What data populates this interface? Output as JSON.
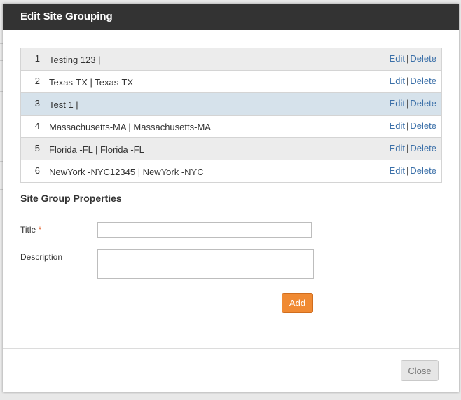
{
  "modal": {
    "title": "Edit Site Grouping"
  },
  "site_groups": [
    {
      "index": "1",
      "name": "Testing 123 |"
    },
    {
      "index": "2",
      "name": "Texas-TX | Texas-TX"
    },
    {
      "index": "3",
      "name": "Test 1 |"
    },
    {
      "index": "4",
      "name": "Massachusetts-MA | Massachusetts-MA"
    },
    {
      "index": "5",
      "name": "Florida -FL | Florida -FL"
    },
    {
      "index": "6",
      "name": "NewYork -NYC12345 | NewYork -NYC"
    }
  ],
  "row_actions": {
    "edit_label": "Edit",
    "separator": "|",
    "delete_label": "Delete"
  },
  "properties": {
    "section_title": "Site Group Properties",
    "title_label": "Title",
    "required_marker": "*",
    "title_value": "",
    "description_label": "Description",
    "description_value": "",
    "add_label": "Add"
  },
  "footer": {
    "close_label": "Close"
  },
  "colors": {
    "header_bg": "#333333",
    "add_button": "#f08a33",
    "link": "#3a6fa8",
    "row_highlight": "#d6e2eb"
  }
}
